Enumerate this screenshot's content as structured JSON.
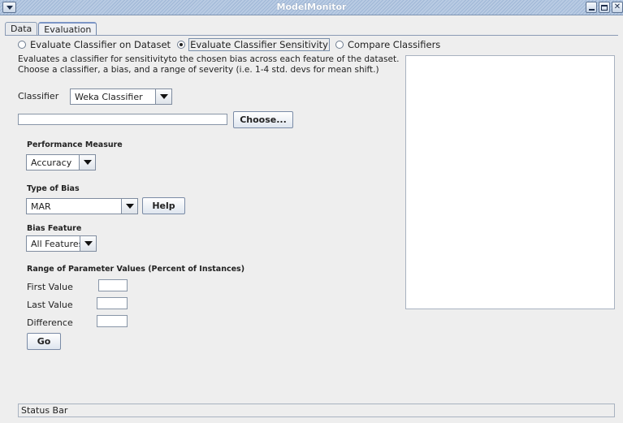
{
  "window": {
    "title": "ModelMonitor"
  },
  "tabs": [
    {
      "label": "Data"
    },
    {
      "label": "Evaluation"
    }
  ],
  "modes": [
    {
      "label": "Evaluate Classifier on Dataset",
      "selected": false
    },
    {
      "label": "Evaluate Classifier Sensitivity",
      "selected": true
    },
    {
      "label": "Compare Classifiers",
      "selected": false
    }
  ],
  "description": "Evaluates a classifier for sensitivityto the chosen bias across each feature of the dataset.  Choose a classifier, a bias, and a range of severity (i.e. 1-4 std. devs for mean shift.)",
  "classifier": {
    "label": "Classifier",
    "selected": "Weka Classifier",
    "path_value": "",
    "choose_label": "Choose..."
  },
  "performance": {
    "label": "Performance Measure",
    "selected": "Accuracy"
  },
  "bias_type": {
    "label": "Type of Bias",
    "selected": "MAR",
    "help_label": "Help"
  },
  "bias_feature": {
    "label": "Bias Feature",
    "selected": "All Features"
  },
  "range": {
    "label": "Range of Parameter Values (Percent of Instances)",
    "first_label": "First Value",
    "first_value": "",
    "last_label": "Last Value",
    "last_value": "",
    "diff_label": "Difference",
    "diff_value": "",
    "go_label": "Go"
  },
  "status": {
    "text": "Status Bar"
  }
}
